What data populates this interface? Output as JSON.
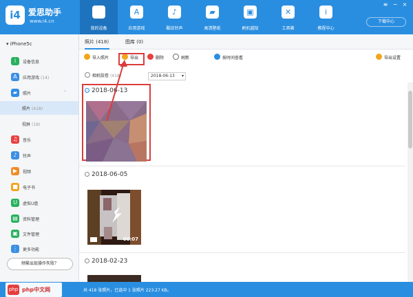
{
  "app": {
    "title": "爱思助手",
    "url": "www.i4.cn",
    "logo_text": "i4"
  },
  "nav": {
    "tabs": [
      {
        "label": "我的设备",
        "icon": "apple-icon",
        "active": true
      },
      {
        "label": "应用游戏",
        "icon": "app-store-icon",
        "active": false
      },
      {
        "label": "酷炫铃声",
        "icon": "bell-icon",
        "active": false
      },
      {
        "label": "高清壁纸",
        "icon": "wallpaper-icon",
        "active": false
      },
      {
        "label": "刷机越狱",
        "icon": "box-icon",
        "active": false
      },
      {
        "label": "工具箱",
        "icon": "tools-icon",
        "active": false
      },
      {
        "label": "教程中心",
        "icon": "info-icon",
        "active": false
      }
    ],
    "download_label": "下载中心"
  },
  "sidebar": {
    "device": "iPhone5c",
    "items": [
      {
        "label": "设备信息",
        "icon": "info-circle-icon",
        "color": "#27b15d"
      },
      {
        "label": "应用游戏",
        "count": "(14)",
        "icon": "app-icon",
        "color": "#3b8fe5"
      },
      {
        "label": "照片",
        "icon": "photo-icon",
        "color": "#2f8ee7"
      },
      {
        "label": "照片",
        "count": "(418)",
        "sub": true,
        "selected": true
      },
      {
        "label": "视屏",
        "count": "(18)",
        "sub": true
      },
      {
        "label": "音乐",
        "icon": "music-icon",
        "color": "#e84040"
      },
      {
        "label": "铃声",
        "icon": "bell-icon",
        "color": "#3b8fe5"
      },
      {
        "label": "视频",
        "icon": "video-icon",
        "color": "#f08c28"
      },
      {
        "label": "电子书",
        "icon": "book-icon",
        "color": "#f2a51c"
      },
      {
        "label": "虚拟U盘",
        "icon": "usb-icon",
        "color": "#27b15d"
      },
      {
        "label": "资料管理",
        "icon": "contacts-icon",
        "color": "#27b15d"
      },
      {
        "label": "文件管理",
        "icon": "folder-icon",
        "color": "#27b15d"
      },
      {
        "label": "更多功能",
        "icon": "grid-icon",
        "color": "#3b8fe5"
      }
    ],
    "help_label": "频繁出现操作失败？"
  },
  "tabs": [
    {
      "label": "照片",
      "count": "(418)",
      "active": true
    },
    {
      "label": "图库",
      "count": "(0)",
      "active": false
    }
  ],
  "toolbar": {
    "import": "导入照片",
    "export": "导出",
    "delete": "删除",
    "refresh": "刷新",
    "by_date": "按时间查看",
    "export_settings": "导出设置"
  },
  "filter": {
    "camera_roll": "相机胶卷",
    "camera_count": "(418)",
    "date": "2018-06-13"
  },
  "groups": [
    {
      "date": "2018-06-13",
      "checked": true
    },
    {
      "date": "2018-06-05",
      "checked": false,
      "duration": "00:07"
    },
    {
      "date": "2018-02-23",
      "checked": false
    }
  ],
  "status": {
    "left_text": "共 418 张照片，已选中 1 张照片 223.27 KB。",
    "watermark": "php中文网",
    "watermark_badge": "php"
  }
}
